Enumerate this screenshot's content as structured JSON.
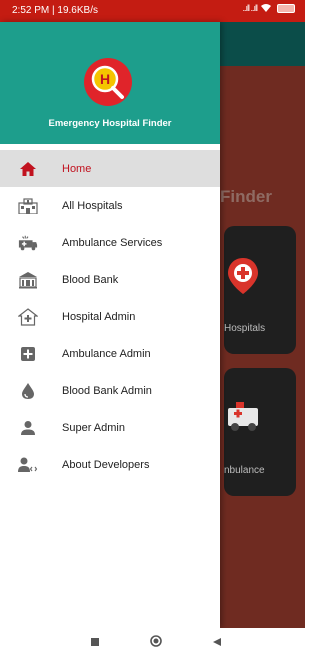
{
  "status_bar": {
    "time_speed": "2:52 PM | 19.6KB/s",
    "signal": "..ıll ..ıll"
  },
  "drawer": {
    "app_title": "Emergency Hospital Finder",
    "logo_letter": "H",
    "menu": [
      {
        "label": "Home",
        "icon": "home-icon",
        "active": true
      },
      {
        "label": "All Hospitals",
        "icon": "hospital-building-icon",
        "active": false
      },
      {
        "label": "Ambulance Services",
        "icon": "ambulance-icon",
        "active": false
      },
      {
        "label": "Blood Bank",
        "icon": "blood-bank-building-icon",
        "active": false
      },
      {
        "label": "Hospital Admin",
        "icon": "hospital-admin-icon",
        "active": false
      },
      {
        "label": "Ambulance Admin",
        "icon": "medical-cross-icon",
        "active": false
      },
      {
        "label": "Blood Bank Admin",
        "icon": "blood-drop-icon",
        "active": false
      },
      {
        "label": "Super Admin",
        "icon": "person-icon",
        "active": false
      },
      {
        "label": "About Developers",
        "icon": "developer-icon",
        "active": false
      }
    ]
  },
  "background_screen": {
    "heading_fragment": "Finder",
    "card1_label": "Hospitals",
    "card2_label": "nbulance"
  },
  "colors": {
    "status_bar": "#c41c12",
    "drawer_header": "#1d9e8c",
    "active_text": "#c1121f",
    "active_background": "#dedede"
  }
}
